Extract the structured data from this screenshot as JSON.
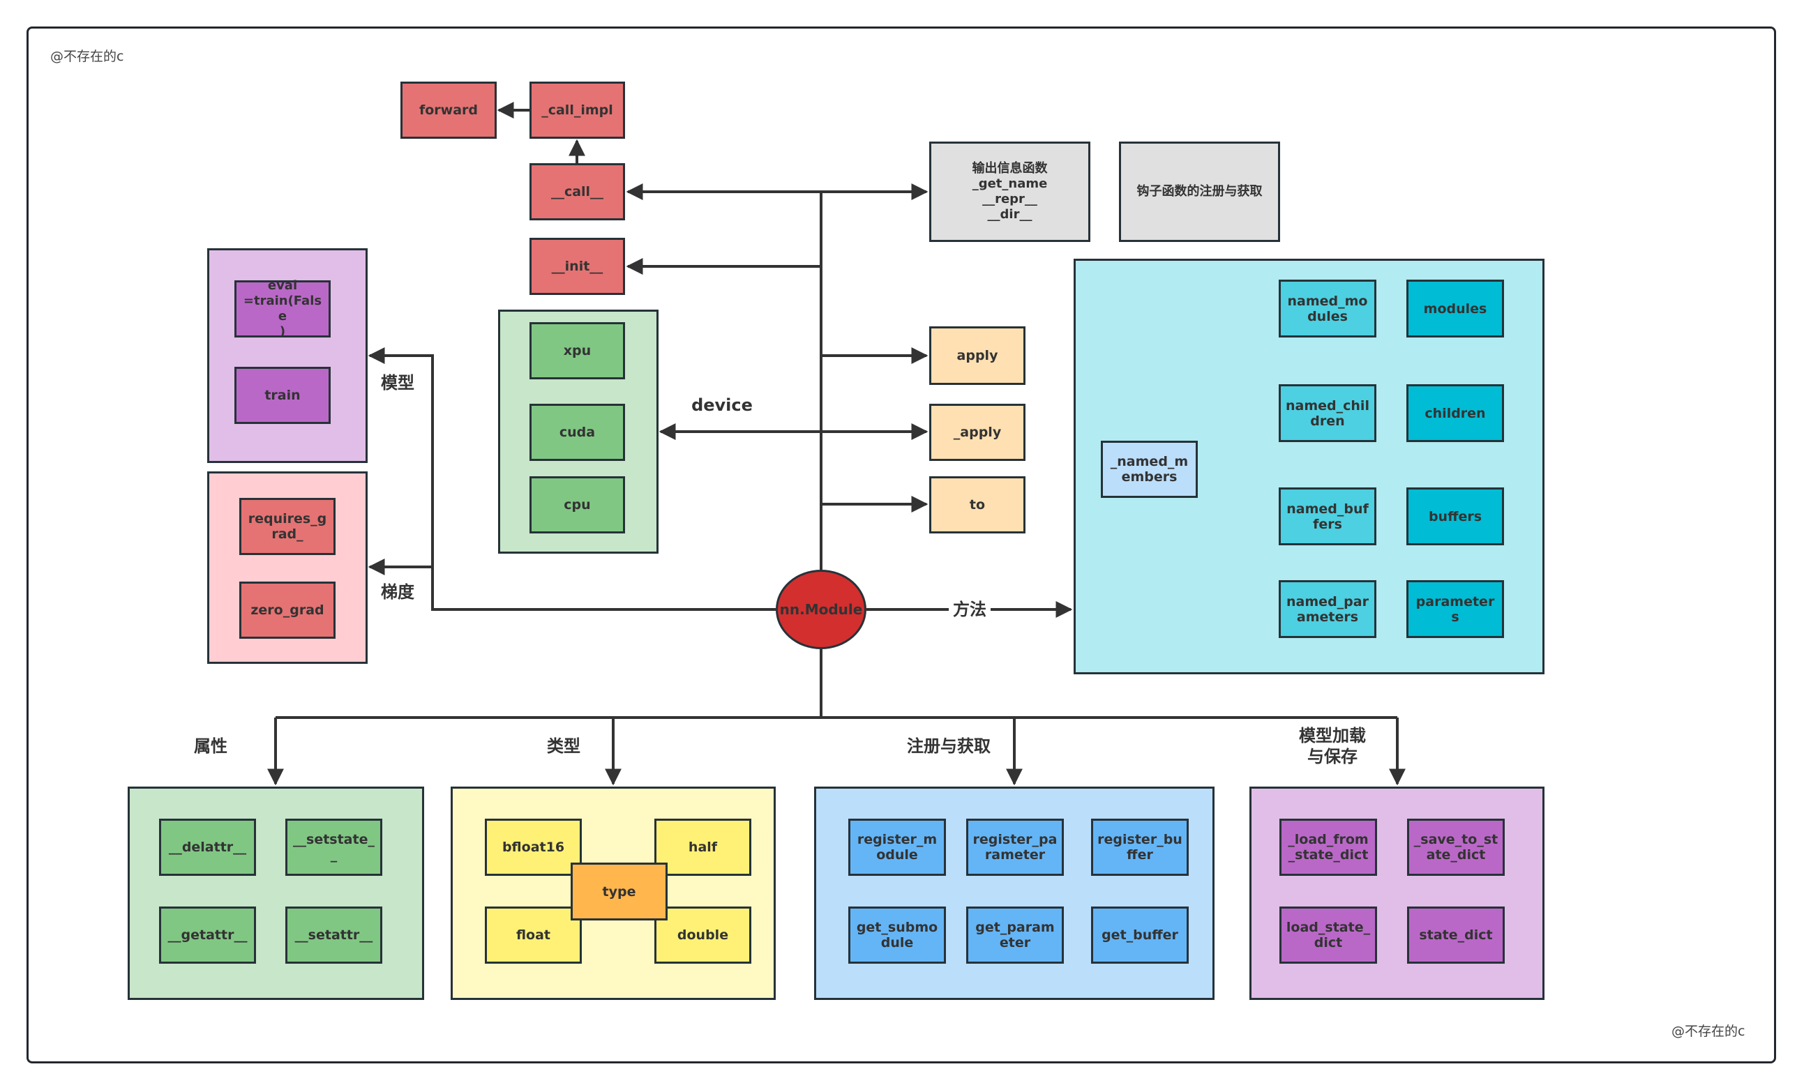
{
  "watermark": "@不存在的c",
  "center": {
    "label": "nn.Module",
    "color": "#d32f2f"
  },
  "call_chain": {
    "forward": "forward",
    "call_impl": "_call_impl",
    "call": "__call__",
    "init": "__init__"
  },
  "device": {
    "label": "device",
    "items": [
      "xpu",
      "cuda",
      "cpu"
    ]
  },
  "info": {
    "output_box": "输出信息函数\n_get_name\n__repr__\n__dir__",
    "hook_box": "钩子函数的注册与获取"
  },
  "apply_group": [
    "apply",
    "_apply",
    "to"
  ],
  "methods": {
    "edge_label": "方法",
    "root": "_named_members",
    "rows": [
      {
        "named": "named_modules",
        "plain": "modules"
      },
      {
        "named": "named_children",
        "plain": "children"
      },
      {
        "named": "named_buffers",
        "plain": "buffers"
      },
      {
        "named": "named_parameters",
        "plain": "parameters"
      }
    ]
  },
  "model": {
    "edge_label": "模型",
    "eval": "eval\n=train(False\n)",
    "train": "train"
  },
  "grad": {
    "edge_label": "梯度",
    "items": [
      "requires_grad_",
      "zero_grad"
    ]
  },
  "attributes": {
    "label": "属性",
    "items": [
      "__delattr__",
      "__setstate__",
      "__getattr__",
      "__setattr__"
    ]
  },
  "types": {
    "label": "类型",
    "center": "type",
    "items": [
      "bfloat16",
      "half",
      "float",
      "double"
    ]
  },
  "register": {
    "label": "注册与获取",
    "pairs": [
      {
        "reg": "register_module",
        "get": "get_submodule"
      },
      {
        "reg": "register_parameter",
        "get": "get_parameter"
      },
      {
        "reg": "register_buffer",
        "get": "get_buffer"
      }
    ]
  },
  "save_load": {
    "label": "模型加载\n与保存",
    "pairs": [
      {
        "top": "_load_from_state_dict",
        "bottom": "load_state_dict"
      },
      {
        "top": "_save_to_state_dict",
        "bottom": "state_dict"
      }
    ]
  }
}
